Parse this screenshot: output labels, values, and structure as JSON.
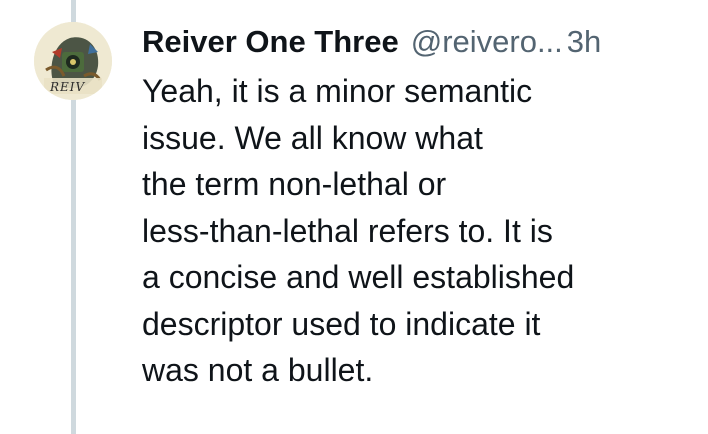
{
  "tweet": {
    "author": {
      "display_name": "Reiver One Three",
      "handle": "@reivero...",
      "avatar_text": "REIV"
    },
    "timestamp": "3h",
    "text": "Yeah, it is a minor semantic\nissue. We all know what\nthe term non-lethal or\nless-than-lethal refers to. It is\na concise and well established\ndescriptor used to indicate it\nwas not a bullet."
  },
  "colors": {
    "thread_line": "#cfd9de",
    "secondary_text": "#536471",
    "primary_text": "#0f1419"
  }
}
